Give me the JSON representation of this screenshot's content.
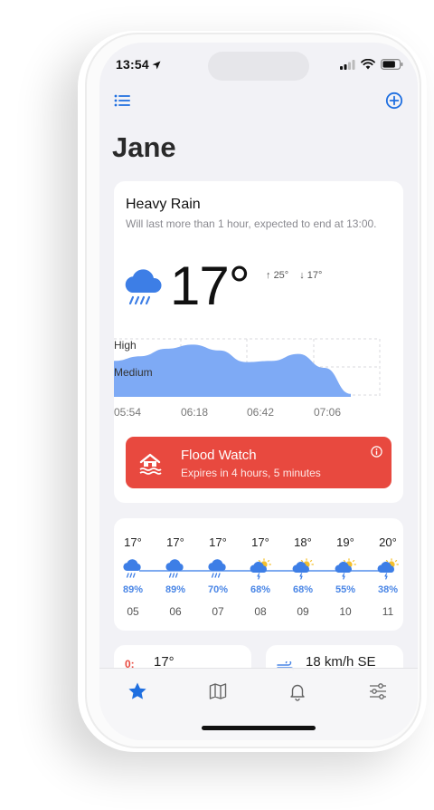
{
  "status_bar": {
    "time": "13:54"
  },
  "header": {
    "title": "Jane"
  },
  "current": {
    "condition": "Heavy Rain",
    "description": "Will last more than 1 hour, expected to end at 13:00.",
    "temperature": "17°",
    "high": "25°",
    "low": "17°",
    "icon": "rain-cloud-icon"
  },
  "precip_chart": {
    "level_labels": [
      "High",
      "Medium"
    ],
    "time_ticks": [
      "05:54",
      "06:18",
      "06:42",
      "07:06"
    ]
  },
  "chart_data": {
    "type": "area",
    "x": [
      "05:54",
      "06:18",
      "06:42",
      "07:06"
    ],
    "series": [
      {
        "values": [
          0.62,
          0.7,
          0.83,
          0.9,
          0.8,
          0.6,
          0.62,
          0.74,
          0.5,
          0.05
        ]
      }
    ],
    "ylim": [
      0,
      1
    ],
    "grid": true
  },
  "alert": {
    "title": "Flood Watch",
    "subtitle": "Expires in 4 hours, 5 minutes",
    "color": "#e8493f",
    "icon": "flooded-house-icon"
  },
  "hourly": [
    {
      "temp": "17°",
      "pct": "89%",
      "hour": "05",
      "icon": "rain-cloud-icon"
    },
    {
      "temp": "17°",
      "pct": "89%",
      "hour": "06",
      "icon": "rain-cloud-icon"
    },
    {
      "temp": "17°",
      "pct": "70%",
      "hour": "07",
      "icon": "rain-cloud-icon"
    },
    {
      "temp": "17°",
      "pct": "68%",
      "hour": "08",
      "icon": "sun-thunder-cloud-icon"
    },
    {
      "temp": "18°",
      "pct": "68%",
      "hour": "09",
      "icon": "sun-thunder-cloud-icon"
    },
    {
      "temp": "19°",
      "pct": "55%",
      "hour": "10",
      "icon": "sun-thunder-cloud-icon"
    },
    {
      "temp": "20°",
      "pct": "38%",
      "hour": "11",
      "icon": "sun-thunder-cloud-icon"
    }
  ],
  "mini_cards": {
    "left_value": "17°",
    "right_value": "18 km/h SE"
  },
  "tabs": [
    "favorites-star-icon",
    "map-icon",
    "notifications-bell-icon",
    "settings-sliders-icon"
  ],
  "colors": {
    "accent": "#1f6fe0",
    "rain": "#4a86e6",
    "chart_fill": "#7eaaf5",
    "alert": "#e8493f"
  }
}
